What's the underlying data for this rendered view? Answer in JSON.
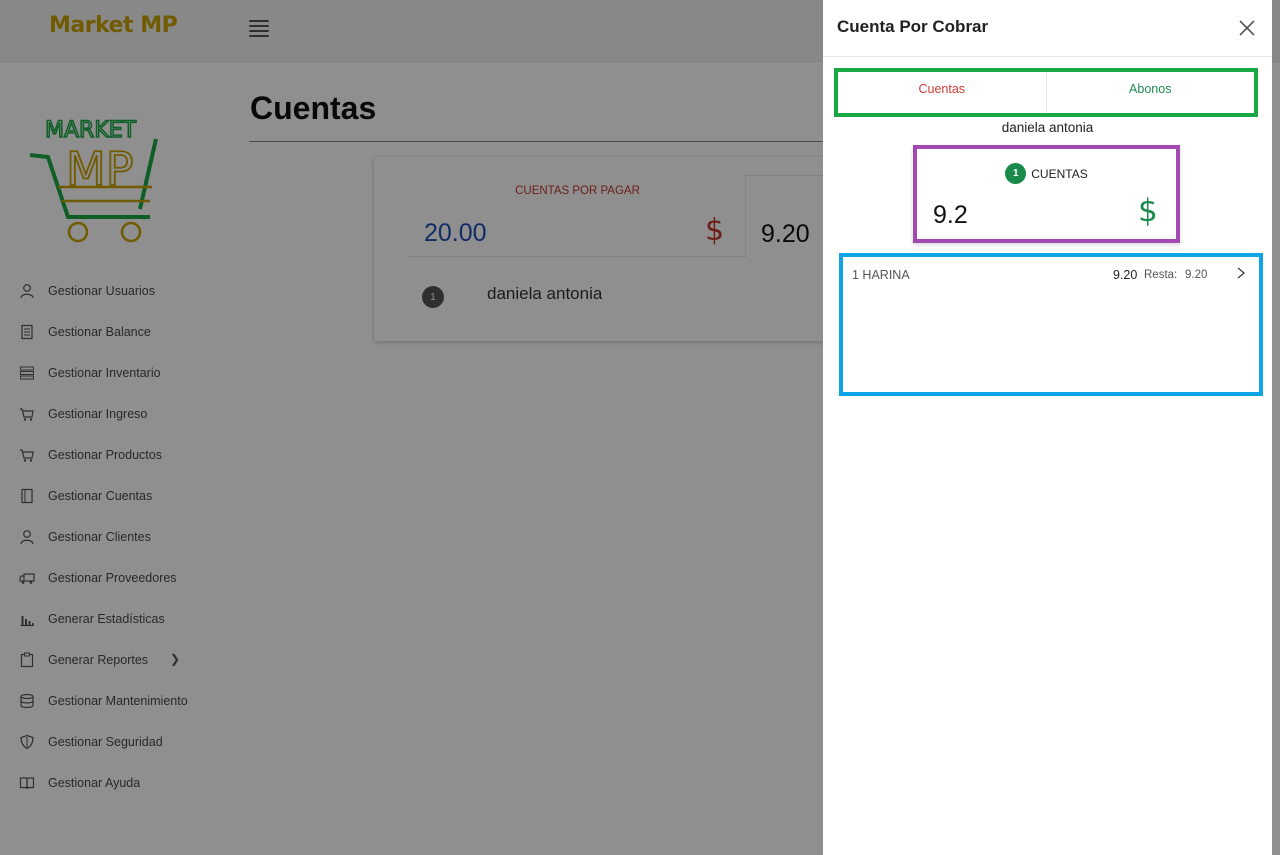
{
  "app": {
    "brand": "Market MP",
    "menu_icon": "hamburger-icon"
  },
  "sidebar": {
    "items": [
      {
        "label": "Gestionar Usuarios",
        "icon": "user-icon"
      },
      {
        "label": "Gestionar Balance",
        "icon": "document-icon"
      },
      {
        "label": "Gestionar Inventario",
        "icon": "list-icon"
      },
      {
        "label": "Gestionar Ingreso",
        "icon": "cart-icon"
      },
      {
        "label": "Gestionar Productos",
        "icon": "cart-icon"
      },
      {
        "label": "Gestionar Cuentas",
        "icon": "book-icon"
      },
      {
        "label": "Gestionar Clientes",
        "icon": "user-icon"
      },
      {
        "label": "Gestionar Proveedores",
        "icon": "truck-icon"
      },
      {
        "label": "Generar Estadísticas",
        "icon": "bar-chart-icon"
      },
      {
        "label": "Generar Reportes",
        "icon": "clipboard-icon"
      },
      {
        "label": "Gestionar Mantenimiento",
        "icon": "database-icon"
      },
      {
        "label": "Gestionar Seguridad",
        "icon": "shield-icon"
      },
      {
        "label": "Gestionar Ayuda",
        "icon": "open-book-icon"
      }
    ]
  },
  "main": {
    "title": "Cuentas",
    "card": {
      "cuentas_por_pagar_label": "CUENTAS POR PAGAR",
      "cuentas_por_pagar_amount": "20.00",
      "currency_symbol": "$",
      "second_amount": "9.20",
      "client_index": "1",
      "client_name": "daniela antonia"
    }
  },
  "modal": {
    "title": "Cuenta Por Cobrar",
    "tabs": {
      "cuentas": "Cuentas",
      "abonos": "Abonos"
    },
    "client_name": "daniela antonia",
    "summary": {
      "count": "1",
      "label": "CUENTAS",
      "amount": "9.2",
      "currency_symbol": "$"
    },
    "items": [
      {
        "name": "1 HARINA",
        "amount": "9.20",
        "rest_label": "Resta:",
        "rest": "9.20"
      }
    ]
  },
  "colors": {
    "brand": "#c9a300",
    "danger": "#d23a3a",
    "success": "#1a8a4a",
    "primary_amount": "#1f4fb5",
    "highlight_tabs": "#1aa845",
    "highlight_summary": "#a24ab2",
    "highlight_items": "#0ea5e6"
  }
}
